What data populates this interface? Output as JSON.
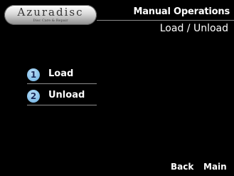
{
  "logo": {
    "name": "Azuradisc",
    "tagline": "Disc Care & Repair"
  },
  "header": {
    "title": "Manual Operations",
    "subtitle": "Load / Unload"
  },
  "menu": {
    "items": [
      {
        "number": "1",
        "label": "Load"
      },
      {
        "number": "2",
        "label": "Unload"
      }
    ]
  },
  "footer": {
    "back_label": "Back",
    "main_label": "Main"
  },
  "colors": {
    "background": "#000000",
    "text": "#ffffff",
    "badge": "#8cc4ec",
    "rule": "#8c8c8c"
  }
}
